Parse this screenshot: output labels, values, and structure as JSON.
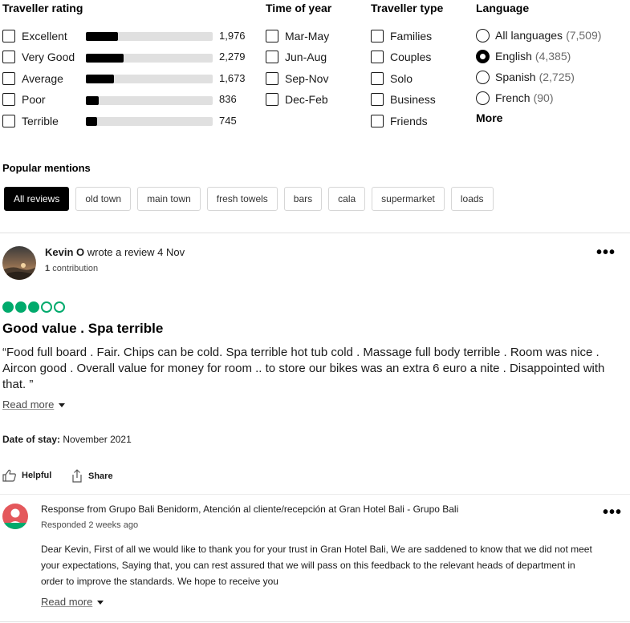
{
  "filters": {
    "traveller_rating": {
      "title": "Traveller rating",
      "items": [
        {
          "label": "Excellent",
          "count": "1,976",
          "fill": 0.25
        },
        {
          "label": "Very Good",
          "count": "2,279",
          "fill": 0.3
        },
        {
          "label": "Average",
          "count": "1,673",
          "fill": 0.22
        },
        {
          "label": "Poor",
          "count": "836",
          "fill": 0.1
        },
        {
          "label": "Terrible",
          "count": "745",
          "fill": 0.09
        }
      ]
    },
    "time_of_year": {
      "title": "Time of year",
      "items": [
        "Mar-May",
        "Jun-Aug",
        "Sep-Nov",
        "Dec-Feb"
      ]
    },
    "traveller_type": {
      "title": "Traveller type",
      "items": [
        "Families",
        "Couples",
        "Solo",
        "Business",
        "Friends"
      ]
    },
    "language": {
      "title": "Language",
      "items": [
        {
          "label": "All languages",
          "count": "(7,509)",
          "selected": false
        },
        {
          "label": "English",
          "count": "(4,385)",
          "selected": true
        },
        {
          "label": "Spanish",
          "count": "(2,725)",
          "selected": false
        },
        {
          "label": "French",
          "count": "(90)",
          "selected": false
        }
      ],
      "more": "More"
    }
  },
  "mentions": {
    "title": "Popular mentions",
    "chips": [
      "All reviews",
      "old town",
      "main town",
      "fresh towels",
      "bars",
      "cala",
      "supermarket",
      "loads"
    ]
  },
  "review": {
    "name": "Kevin O",
    "action": "wrote a review 4 Nov",
    "contribution_count": "1",
    "contribution_label": "contribution",
    "rating": 3,
    "rating_max": 5,
    "title": "Good value . Spa terrible",
    "text": "“Food full board . Fair. Chips can be cold. Spa terrible hot tub cold . Massage full body terrible . Room was nice . Aircon good . Overall value for money for room .. to store our bikes was an extra 6 euro a nite . Disappointed with that. ”",
    "read_more": "Read more",
    "date_label": "Date of stay:",
    "date_value": "November 2021",
    "helpful": "Helpful",
    "share": "Share"
  },
  "response": {
    "title": "Response from Grupo Bali Benidorm, Atención al cliente/recepción at Gran Hotel Bali - Grupo Bali",
    "date": "Responded 2 weeks ago",
    "text": "Dear Kevin, First of all we would like to thank you for your trust in Gran Hotel Bali, We are saddened to know that we did not meet your expectations, Saying that, you can rest assured that we will pass on this feedback to the relevant heads of department in order to improve the standards. We hope to receive you",
    "read_more": "Read more"
  },
  "colors": {
    "rating_bubble": "#00aa6c",
    "chip_active_bg": "#000000",
    "response_avatar": "#e4585c"
  }
}
